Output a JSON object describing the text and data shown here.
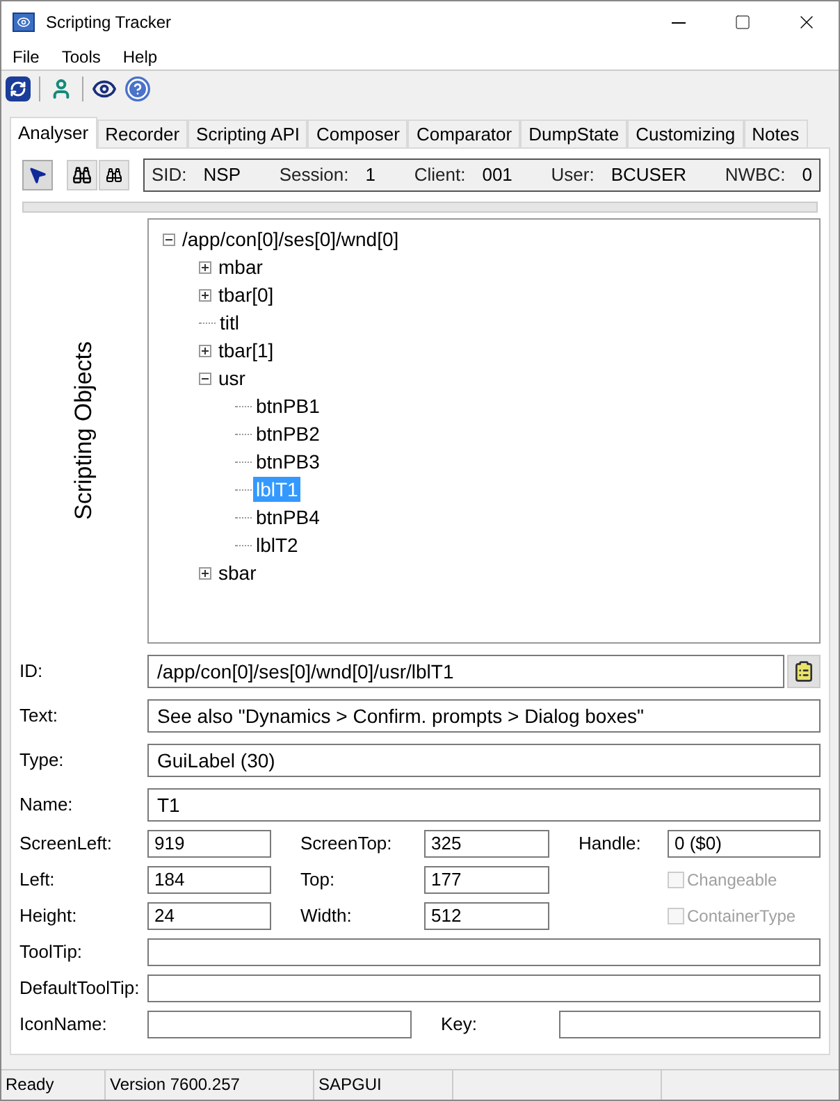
{
  "window": {
    "title": "Scripting Tracker"
  },
  "menu": [
    "File",
    "Tools",
    "Help"
  ],
  "tabs": [
    {
      "label": "Analyser",
      "selected": true
    },
    {
      "label": "Recorder",
      "selected": false
    },
    {
      "label": "Scripting API",
      "selected": false
    },
    {
      "label": "Composer",
      "selected": false
    },
    {
      "label": "Comparator",
      "selected": false
    },
    {
      "label": "DumpState",
      "selected": false
    },
    {
      "label": "Customizing",
      "selected": false
    },
    {
      "label": "Notes",
      "selected": false
    }
  ],
  "session": [
    {
      "label": "SID:",
      "value": "NSP"
    },
    {
      "label": "Session:",
      "value": "1"
    },
    {
      "label": "Client:",
      "value": "001"
    },
    {
      "label": "User:",
      "value": "BCUSER"
    },
    {
      "label": "NWBC:",
      "value": "0"
    }
  ],
  "side_label": "Scripting Objects",
  "tree": [
    {
      "label": "/app/con[0]/ses[0]/wnd[0]",
      "expanded": true,
      "selected": false,
      "children": [
        {
          "label": "mbar",
          "expanded": false,
          "selected": false
        },
        {
          "label": "tbar[0]",
          "expanded": false,
          "selected": false
        },
        {
          "label": "titl",
          "selected": false
        },
        {
          "label": "tbar[1]",
          "expanded": false,
          "selected": false
        },
        {
          "label": "usr",
          "expanded": true,
          "selected": false,
          "children": [
            {
              "label": "btnPB1",
              "selected": false
            },
            {
              "label": "btnPB2",
              "selected": false
            },
            {
              "label": "btnPB3",
              "selected": false
            },
            {
              "label": "lblT1",
              "selected": true
            },
            {
              "label": "btnPB4",
              "selected": false
            },
            {
              "label": "lblT2",
              "selected": false
            }
          ]
        },
        {
          "label": "sbar",
          "expanded": false,
          "selected": false
        }
      ]
    }
  ],
  "fields": {
    "id": {
      "label": "ID:",
      "value": "/app/con[0]/ses[0]/wnd[0]/usr/lblT1"
    },
    "text": {
      "label": "Text:",
      "value": "See also \"Dynamics > Confirm. prompts > Dialog boxes\""
    },
    "type": {
      "label": "Type:",
      "value": "GuiLabel (30)"
    },
    "name": {
      "label": "Name:",
      "value": "T1"
    },
    "screen_left": {
      "label": "ScreenLeft:",
      "value": "919"
    },
    "screen_top": {
      "label": "ScreenTop:",
      "value": "325"
    },
    "handle": {
      "label": "Handle:",
      "value": "0 ($0)"
    },
    "left": {
      "label": "Left:",
      "value": "184"
    },
    "top": {
      "label": "Top:",
      "value": "177"
    },
    "height": {
      "label": "Height:",
      "value": "24"
    },
    "width": {
      "label": "Width:",
      "value": "512"
    },
    "tooltip": {
      "label": "ToolTip:"
    },
    "default_tooltip": {
      "label": "DefaultToolTip:"
    },
    "icon_name": {
      "label": "IconName:"
    },
    "key": {
      "label": "Key:"
    }
  },
  "checkboxes": [
    {
      "label": "Changeable",
      "checked": false,
      "disabled": true
    },
    {
      "label": "ContainerType",
      "checked": false,
      "disabled": true
    }
  ],
  "status_bar": [
    "Ready",
    "Version 7600.257",
    "SAPGUI"
  ]
}
